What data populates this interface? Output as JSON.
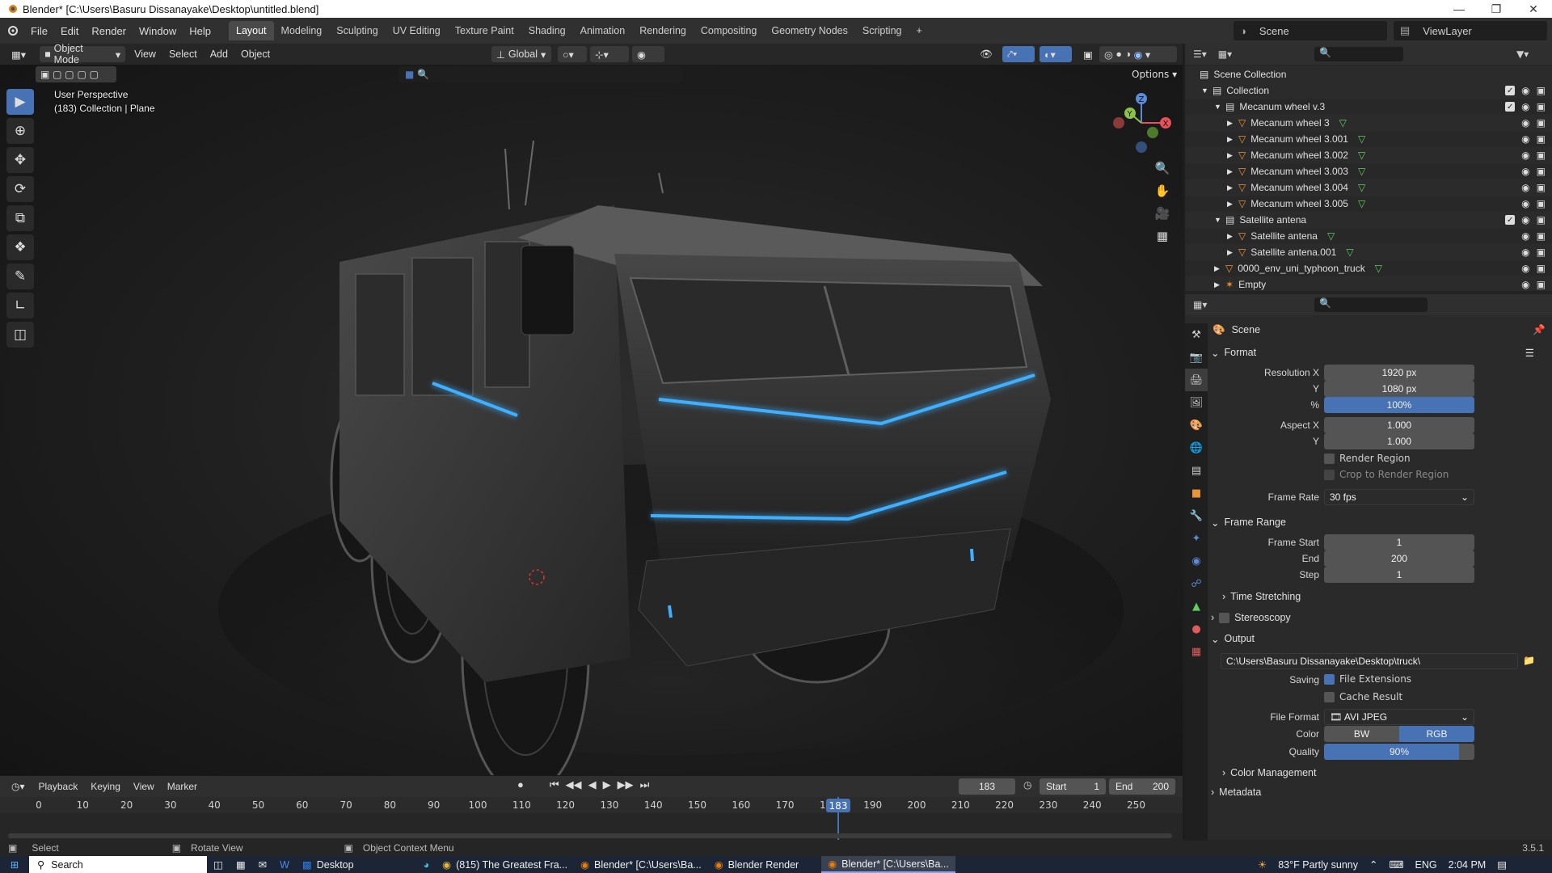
{
  "window": {
    "title": "Blender* [C:\\Users\\Basuru Dissanayake\\Desktop\\untitled.blend]"
  },
  "menubar": {
    "menus": [
      "File",
      "Edit",
      "Render",
      "Window",
      "Help"
    ],
    "workspaces": [
      "Layout",
      "Modeling",
      "Sculpting",
      "UV Editing",
      "Texture Paint",
      "Shading",
      "Animation",
      "Rendering",
      "Compositing",
      "Geometry Nodes",
      "Scripting"
    ],
    "active_workspace": "Layout",
    "scene_label": "Scene",
    "view_layer_label": "ViewLayer"
  },
  "viewport": {
    "mode": "Object Mode",
    "menus": [
      "View",
      "Select",
      "Add",
      "Object"
    ],
    "transform_orientation": "Global",
    "options_label": "Options",
    "view_name": "User Perspective",
    "view_context": "(183) Collection | Plane",
    "gizmo_axes": {
      "z": "Z",
      "y": "Y",
      "x": "X"
    }
  },
  "timeline": {
    "menus": [
      "Playback",
      "Keying",
      "View",
      "Marker"
    ],
    "current_frame": "183",
    "start_label": "Start",
    "start_value": "1",
    "end_label": "End",
    "end_value": "200",
    "ticks": [
      "0",
      "10",
      "20",
      "30",
      "40",
      "50",
      "60",
      "70",
      "80",
      "90",
      "100",
      "110",
      "120",
      "130",
      "140",
      "150",
      "160",
      "170",
      "180",
      "190",
      "200",
      "210",
      "220",
      "230",
      "240",
      "250"
    ],
    "playhead_label": "183"
  },
  "statusbar": {
    "select": "Select",
    "rotate": "Rotate View",
    "context": "Object Context Menu",
    "version": "3.5.1"
  },
  "outliner": {
    "root": "Scene Collection",
    "rows": [
      {
        "label": "Collection",
        "indent": 1,
        "type": "collection"
      },
      {
        "label": "Mecanum wheel v.3",
        "indent": 2,
        "type": "collection"
      },
      {
        "label": "Mecanum wheel 3",
        "indent": 3,
        "type": "mesh"
      },
      {
        "label": "Mecanum wheel 3.001",
        "indent": 3,
        "type": "mesh"
      },
      {
        "label": "Mecanum wheel 3.002",
        "indent": 3,
        "type": "mesh"
      },
      {
        "label": "Mecanum wheel 3.003",
        "indent": 3,
        "type": "mesh"
      },
      {
        "label": "Mecanum wheel 3.004",
        "indent": 3,
        "type": "mesh"
      },
      {
        "label": "Mecanum wheel 3.005",
        "indent": 3,
        "type": "mesh"
      },
      {
        "label": "Satellite antena",
        "indent": 2,
        "type": "collection"
      },
      {
        "label": "Satellite antena",
        "indent": 3,
        "type": "mesh"
      },
      {
        "label": "Satellite antena.001",
        "indent": 3,
        "type": "mesh"
      },
      {
        "label": "0000_env_uni_typhoon_truck",
        "indent": 2,
        "type": "mesh"
      },
      {
        "label": "Empty",
        "indent": 2,
        "type": "empty"
      }
    ]
  },
  "properties": {
    "context": "Scene",
    "format": {
      "header": "Format",
      "resolution_x_label": "Resolution X",
      "resolution_x": "1920 px",
      "resolution_y_label": "Y",
      "resolution_y": "1080 px",
      "percent_label": "%",
      "percent": "100%",
      "aspect_x_label": "Aspect X",
      "aspect_x": "1.000",
      "aspect_y_label": "Y",
      "aspect_y": "1.000",
      "render_region": "Render Region",
      "crop_region": "Crop to Render Region",
      "frame_rate_label": "Frame Rate",
      "frame_rate": "30 fps"
    },
    "frame_range": {
      "header": "Frame Range",
      "start_label": "Frame Start",
      "start": "1",
      "end_label": "End",
      "end": "200",
      "step_label": "Step",
      "step": "1",
      "time_stretching": "Time Stretching"
    },
    "stereoscopy": "Stereoscopy",
    "output": {
      "header": "Output",
      "path": "C:\\Users\\Basuru Dissanayake\\Desktop\\truck\\",
      "saving_label": "Saving",
      "file_extensions": "File Extensions",
      "cache_result": "Cache Result",
      "file_format_label": "File Format",
      "file_format": "AVI JPEG",
      "color_label": "Color",
      "color_bw": "BW",
      "color_rgb": "RGB",
      "quality_label": "Quality",
      "quality": "90%",
      "color_management": "Color Management"
    },
    "metadata": "Metadata"
  },
  "taskbar": {
    "search": "Search",
    "apps": [
      "Desktop",
      "(815) The Greatest Fra...",
      "Blender* [C:\\Users\\Ba...",
      "Blender Render",
      "Blender* [C:\\Users\\Ba..."
    ],
    "weather": "83°F  Partly sunny",
    "lang": "ENG",
    "time": "2:04 PM"
  },
  "colors": {
    "accent": "#4772b3",
    "panel": "#2a2a2a",
    "header": "#303030",
    "glow": "#3fb0ff"
  }
}
